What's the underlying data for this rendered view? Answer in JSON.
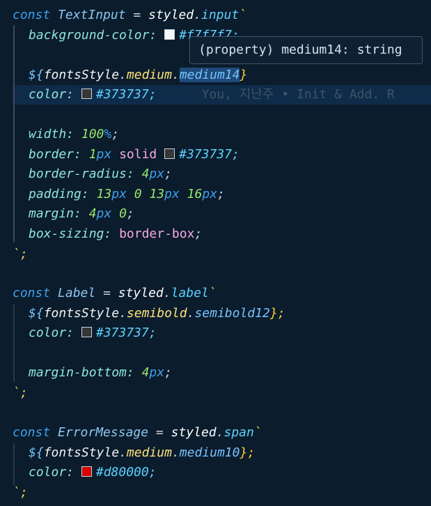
{
  "colors": {
    "background": "#0b1c2c",
    "current_line": "#0f2b4a",
    "selection": "#1d4a7a"
  },
  "code": {
    "text_input": {
      "kw": "const",
      "name": "TextInput",
      "eq": "=",
      "styled": "styled",
      "tag": "input",
      "tick": "`",
      "bg_prop": "background-color:",
      "bg_value": "#f7f7f7;",
      "bg_swatch": "#f7f7f7",
      "mixin_open": "${",
      "mixin_obj": "fontsStyle",
      "mixin_member": "medium",
      "mixin_leaf": "medium14",
      "mixin_close": "}",
      "color_prop": "color:",
      "color_value": "#373737;",
      "color_swatch": "#373737",
      "blame": "You, 지난주 • Init & Add. R",
      "width_prop": "width:",
      "width_num": "100",
      "width_unit": "%",
      "border_prop": "border:",
      "border_num": "1",
      "border_unit": "px",
      "border_word": "solid",
      "border_value": "#373737;",
      "border_swatch": "#373737",
      "radius_prop": "border-radius:",
      "radius_num": "4",
      "radius_unit": "px",
      "padding_prop": "padding:",
      "padding_a": "13",
      "padding_b": "0",
      "padding_c": "13",
      "padding_d": "16",
      "padding_unit": "px",
      "margin_prop": "margin:",
      "margin_a": "4",
      "margin_b": "0",
      "margin_unit": "px",
      "sizing_prop": "box-sizing:",
      "sizing_word": "border-box",
      "close": "`;"
    },
    "label": {
      "kw": "const",
      "name": "Label",
      "eq": "=",
      "styled": "styled",
      "tag": "label",
      "tick": "`",
      "mixin_open": "${",
      "mixin_obj": "fontsStyle",
      "mixin_member": "semibold",
      "mixin_leaf": "semibold12",
      "mixin_close": "};",
      "color_prop": "color:",
      "color_value": "#373737;",
      "color_swatch": "#373737",
      "mb_prop": "margin-bottom:",
      "mb_num": "4",
      "mb_unit": "px",
      "close": "`;"
    },
    "error": {
      "kw": "const",
      "name": "ErrorMessage",
      "eq": "=",
      "styled": "styled",
      "tag": "span",
      "tick": "`",
      "mixin_open": "${",
      "mixin_obj": "fontsStyle",
      "mixin_member": "medium",
      "mixin_leaf": "medium10",
      "mixin_close": "};",
      "color_prop": "color:",
      "color_value": "#d80000;",
      "color_swatch": "#d80000",
      "close": "`;"
    }
  },
  "tooltip": {
    "text": "(property) medium14: string"
  }
}
